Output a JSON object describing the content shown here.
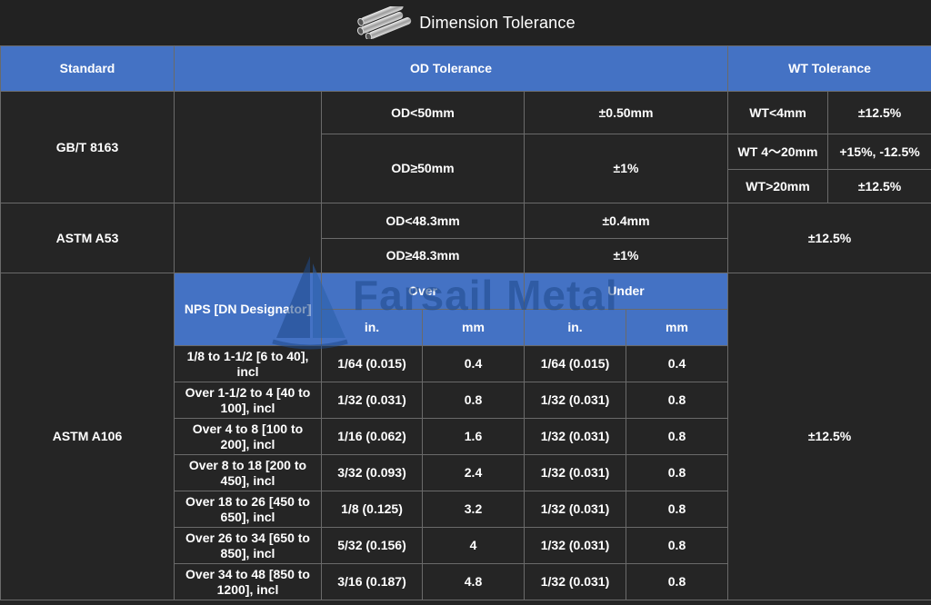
{
  "title": "Dimension Tolerance",
  "watermark": "Farsail Metal",
  "headers": {
    "standard": "Standard",
    "od": "OD Tolerance",
    "wt": "WT Tolerance"
  },
  "gbt": {
    "standard": "GB/T 8163",
    "od_rows": [
      {
        "cond": "OD<50mm",
        "tol": "±0.50mm"
      },
      {
        "cond": "OD≥50mm",
        "tol": "±1%"
      }
    ],
    "wt_rows": [
      {
        "cond": "WT<4mm",
        "tol": "±12.5%"
      },
      {
        "cond": "WT 4～20mm",
        "tol": "+15%, -12.5%"
      },
      {
        "cond": "WT>20mm",
        "tol": "±12.5%"
      }
    ]
  },
  "a53": {
    "standard": "ASTM A53",
    "od_rows": [
      {
        "cond": "OD<48.3mm",
        "tol": "±0.4mm"
      },
      {
        "cond": "OD≥48.3mm",
        "tol": "±1%"
      }
    ],
    "wt": "±12.5%"
  },
  "a106": {
    "standard": "ASTM A106",
    "nps_label": "NPS [DN Designator]",
    "over_label": "Over",
    "under_label": "Under",
    "in_label": "in.",
    "mm_label": "mm",
    "wt": "±12.5%",
    "rows": [
      {
        "nps": "1/8 to 1-1/2 [6 to 40], incl",
        "over_in": "1/64 (0.015)",
        "over_mm": "0.4",
        "under_in": "1/64 (0.015)",
        "under_mm": "0.4"
      },
      {
        "nps": "Over 1-1/2 to 4 [40 to 100], incl",
        "over_in": "1/32 (0.031)",
        "over_mm": "0.8",
        "under_in": "1/32 (0.031)",
        "under_mm": "0.8"
      },
      {
        "nps": "Over 4 to 8 [100 to 200], incl",
        "over_in": "1/16 (0.062)",
        "over_mm": "1.6",
        "under_in": "1/32 (0.031)",
        "under_mm": "0.8"
      },
      {
        "nps": "Over 8 to 18 [200 to 450], incl",
        "over_in": "3/32 (0.093)",
        "over_mm": "2.4",
        "under_in": "1/32 (0.031)",
        "under_mm": "0.8"
      },
      {
        "nps": "Over 18 to 26 [450 to 650], incl",
        "over_in": "1/8 (0.125)",
        "over_mm": "3.2",
        "under_in": "1/32 (0.031)",
        "under_mm": "0.8"
      },
      {
        "nps": "Over 26 to 34 [650 to 850], incl",
        "over_in": "5/32 (0.156)",
        "over_mm": "4",
        "under_in": "1/32 (0.031)",
        "under_mm": "0.8"
      },
      {
        "nps": "Over 34 to 48 [850 to 1200], incl",
        "over_in": "3/16 (0.187)",
        "over_mm": "4.8",
        "under_in": "1/32 (0.031)",
        "under_mm": "0.8"
      }
    ]
  },
  "colors": {
    "header_blue": "#4472c4",
    "background": "#252525",
    "border": "#6a6a6a"
  }
}
